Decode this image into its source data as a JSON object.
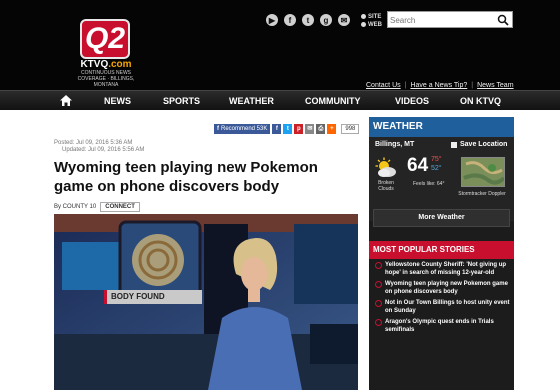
{
  "header": {
    "logo": {
      "text": "Q2",
      "callsign": "KTVQ",
      "dotcom": ".com",
      "tagline": "CONTINUOUS NEWS COVERAGE · BILLINGS, MONTANA"
    },
    "social_icons": [
      "youtube-icon",
      "facebook-icon",
      "twitter-icon",
      "google-plus-icon",
      "email-icon"
    ],
    "search": {
      "scope_site": "SITE",
      "scope_web": "WEB",
      "placeholder": "Search"
    },
    "utility_links": [
      "Contact Us",
      "Have a News Tip?",
      "News Team"
    ]
  },
  "nav": {
    "items": [
      "NEWS",
      "SPORTS",
      "WEATHER",
      "COMMUNITY",
      "VIDEOS",
      "ON KTVQ"
    ]
  },
  "article": {
    "share": {
      "recommend": "Recommend 53K",
      "count": "998"
    },
    "posted": "Posted: Jul 09, 2016 5:36 AM",
    "updated": "Updated: Jul 09, 2016 5:56 AM",
    "headline": "Wyoming teen playing new Pokemon game on phone discovers body",
    "byline": "By COUNTY 10",
    "connect": "CONNECT",
    "video_lower_third": "BODY FOUND"
  },
  "weather": {
    "title": "WEATHER",
    "city": "Billings, MT",
    "save_location": "Save Location",
    "temp": "64",
    "high": "75°",
    "low": "52°",
    "condition": "Broken Clouds",
    "feels_like": "Feels like: 64°",
    "radar_label": "Stormtracker Doppler",
    "more": "More Weather"
  },
  "popular": {
    "title": "MOST POPULAR STORIES",
    "items": [
      "Yellowstone County Sheriff: 'Not giving up hope' in search of missing 12-year-old",
      "Wyoming teen playing new Pokemon game on phone discovers body",
      "Not in Our Town Billings to host unity event on Sunday",
      "Aragon's Olympic quest ends in Trials semifinals"
    ]
  },
  "colors": {
    "brand_red": "#c8102e",
    "weather_blue": "#1f5f9b",
    "facebook": "#3b5998",
    "nav_bg": "#1a1a1a"
  }
}
